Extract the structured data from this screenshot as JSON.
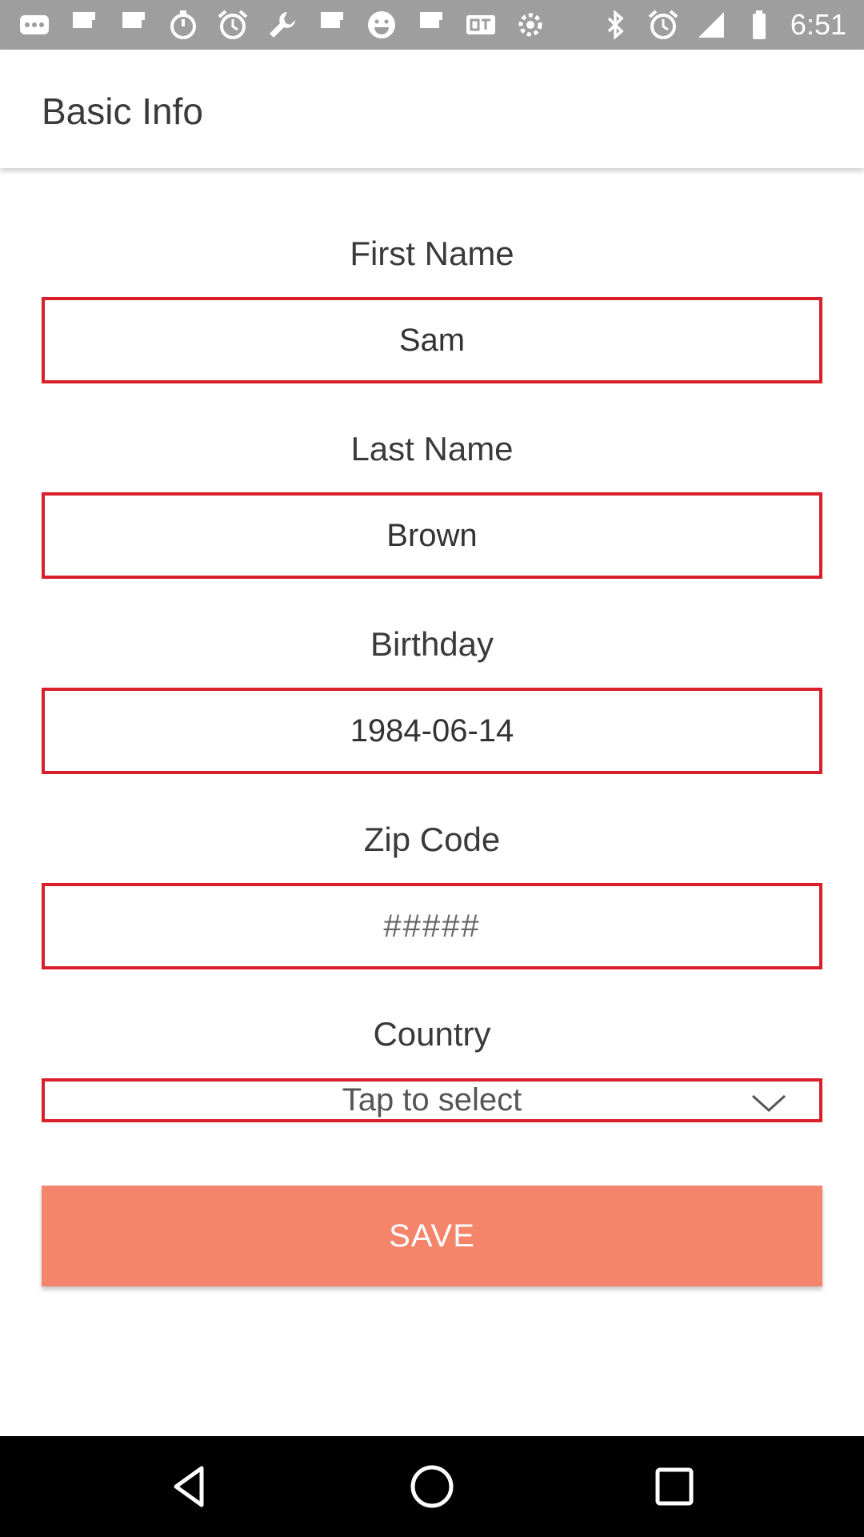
{
  "status_bar": {
    "time": "6:51",
    "left_icons": [
      "more-icon",
      "flipboard-icon",
      "flipboard-icon",
      "stopwatch-icon",
      "alarm-icon",
      "wrench-icon",
      "flipboard-icon",
      "smiley-icon",
      "flipboard-icon",
      "qt-icon",
      "settings-icon"
    ],
    "right_icons": [
      "bluetooth-icon",
      "alarm-icon",
      "signal-icon",
      "battery-icon"
    ]
  },
  "app_bar": {
    "title": "Basic Info"
  },
  "form": {
    "first_name": {
      "label": "First Name",
      "value": "Sam"
    },
    "last_name": {
      "label": "Last Name",
      "value": "Brown"
    },
    "birthday": {
      "label": "Birthday",
      "value": "1984-06-14"
    },
    "zip_code": {
      "label": "Zip Code",
      "value": "",
      "placeholder": "#####"
    },
    "country": {
      "label": "Country",
      "selected": "Tap to select"
    },
    "save_label": "SAVE"
  },
  "colors": {
    "field_border": "#d9202a",
    "save_button": "#f4846a",
    "status_bar": "#9e9e9e",
    "nav_bar": "#000000"
  },
  "nav_bar": {
    "buttons": [
      "back-icon",
      "home-icon",
      "recents-icon"
    ]
  }
}
